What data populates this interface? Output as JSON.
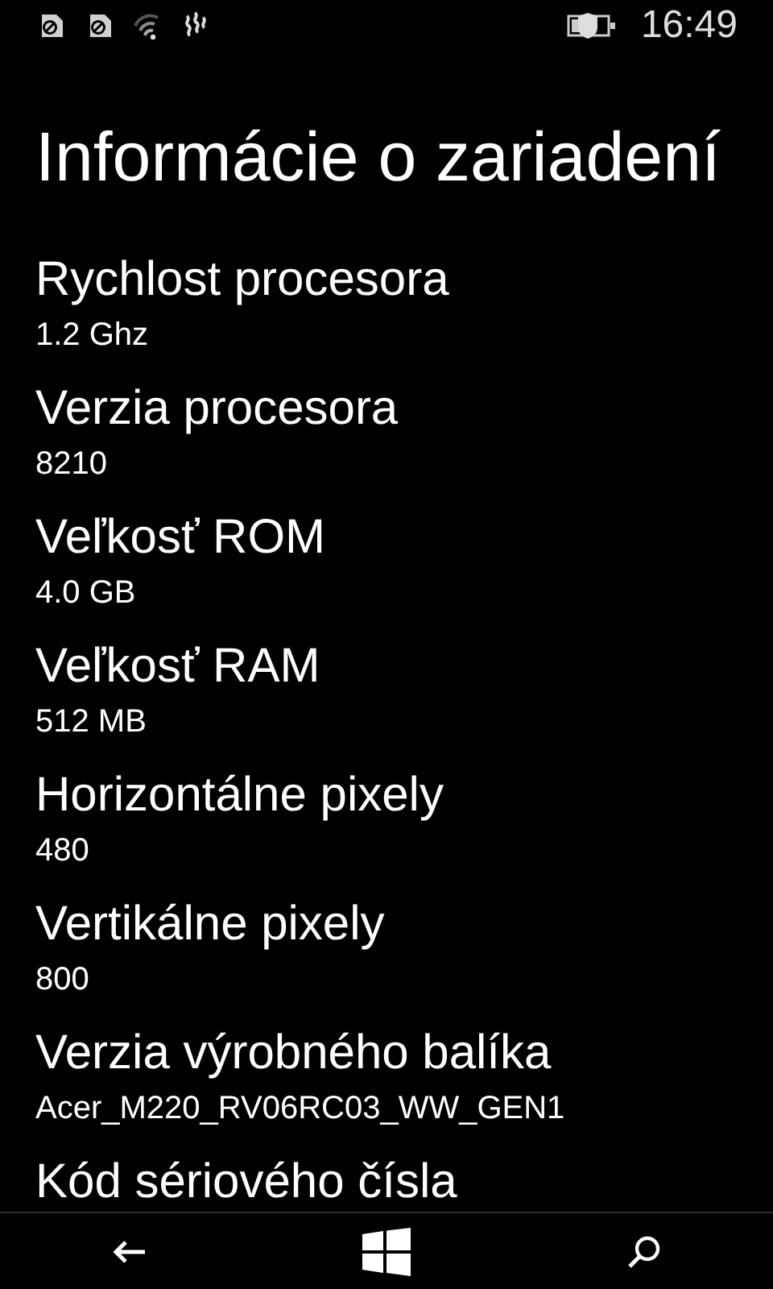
{
  "status_bar": {
    "time": "16:49"
  },
  "page": {
    "title": "Informácie o zariadení"
  },
  "properties": [
    {
      "label": "Rychlost procesora",
      "value": "1.2 Ghz"
    },
    {
      "label": "Verzia procesora",
      "value": "8210"
    },
    {
      "label": "Veľkosť ROM",
      "value": "4.0 GB"
    },
    {
      "label": "Veľkosť RAM",
      "value": "512 MB"
    },
    {
      "label": "Horizontálne pixely",
      "value": "480"
    },
    {
      "label": "Vertikálne pixely",
      "value": "800"
    },
    {
      "label": "Verzia výrobného balíka",
      "value": "Acer_M220_RV06RC03_WW_GEN1"
    },
    {
      "label": "Kód sériového čísla"
    }
  ]
}
